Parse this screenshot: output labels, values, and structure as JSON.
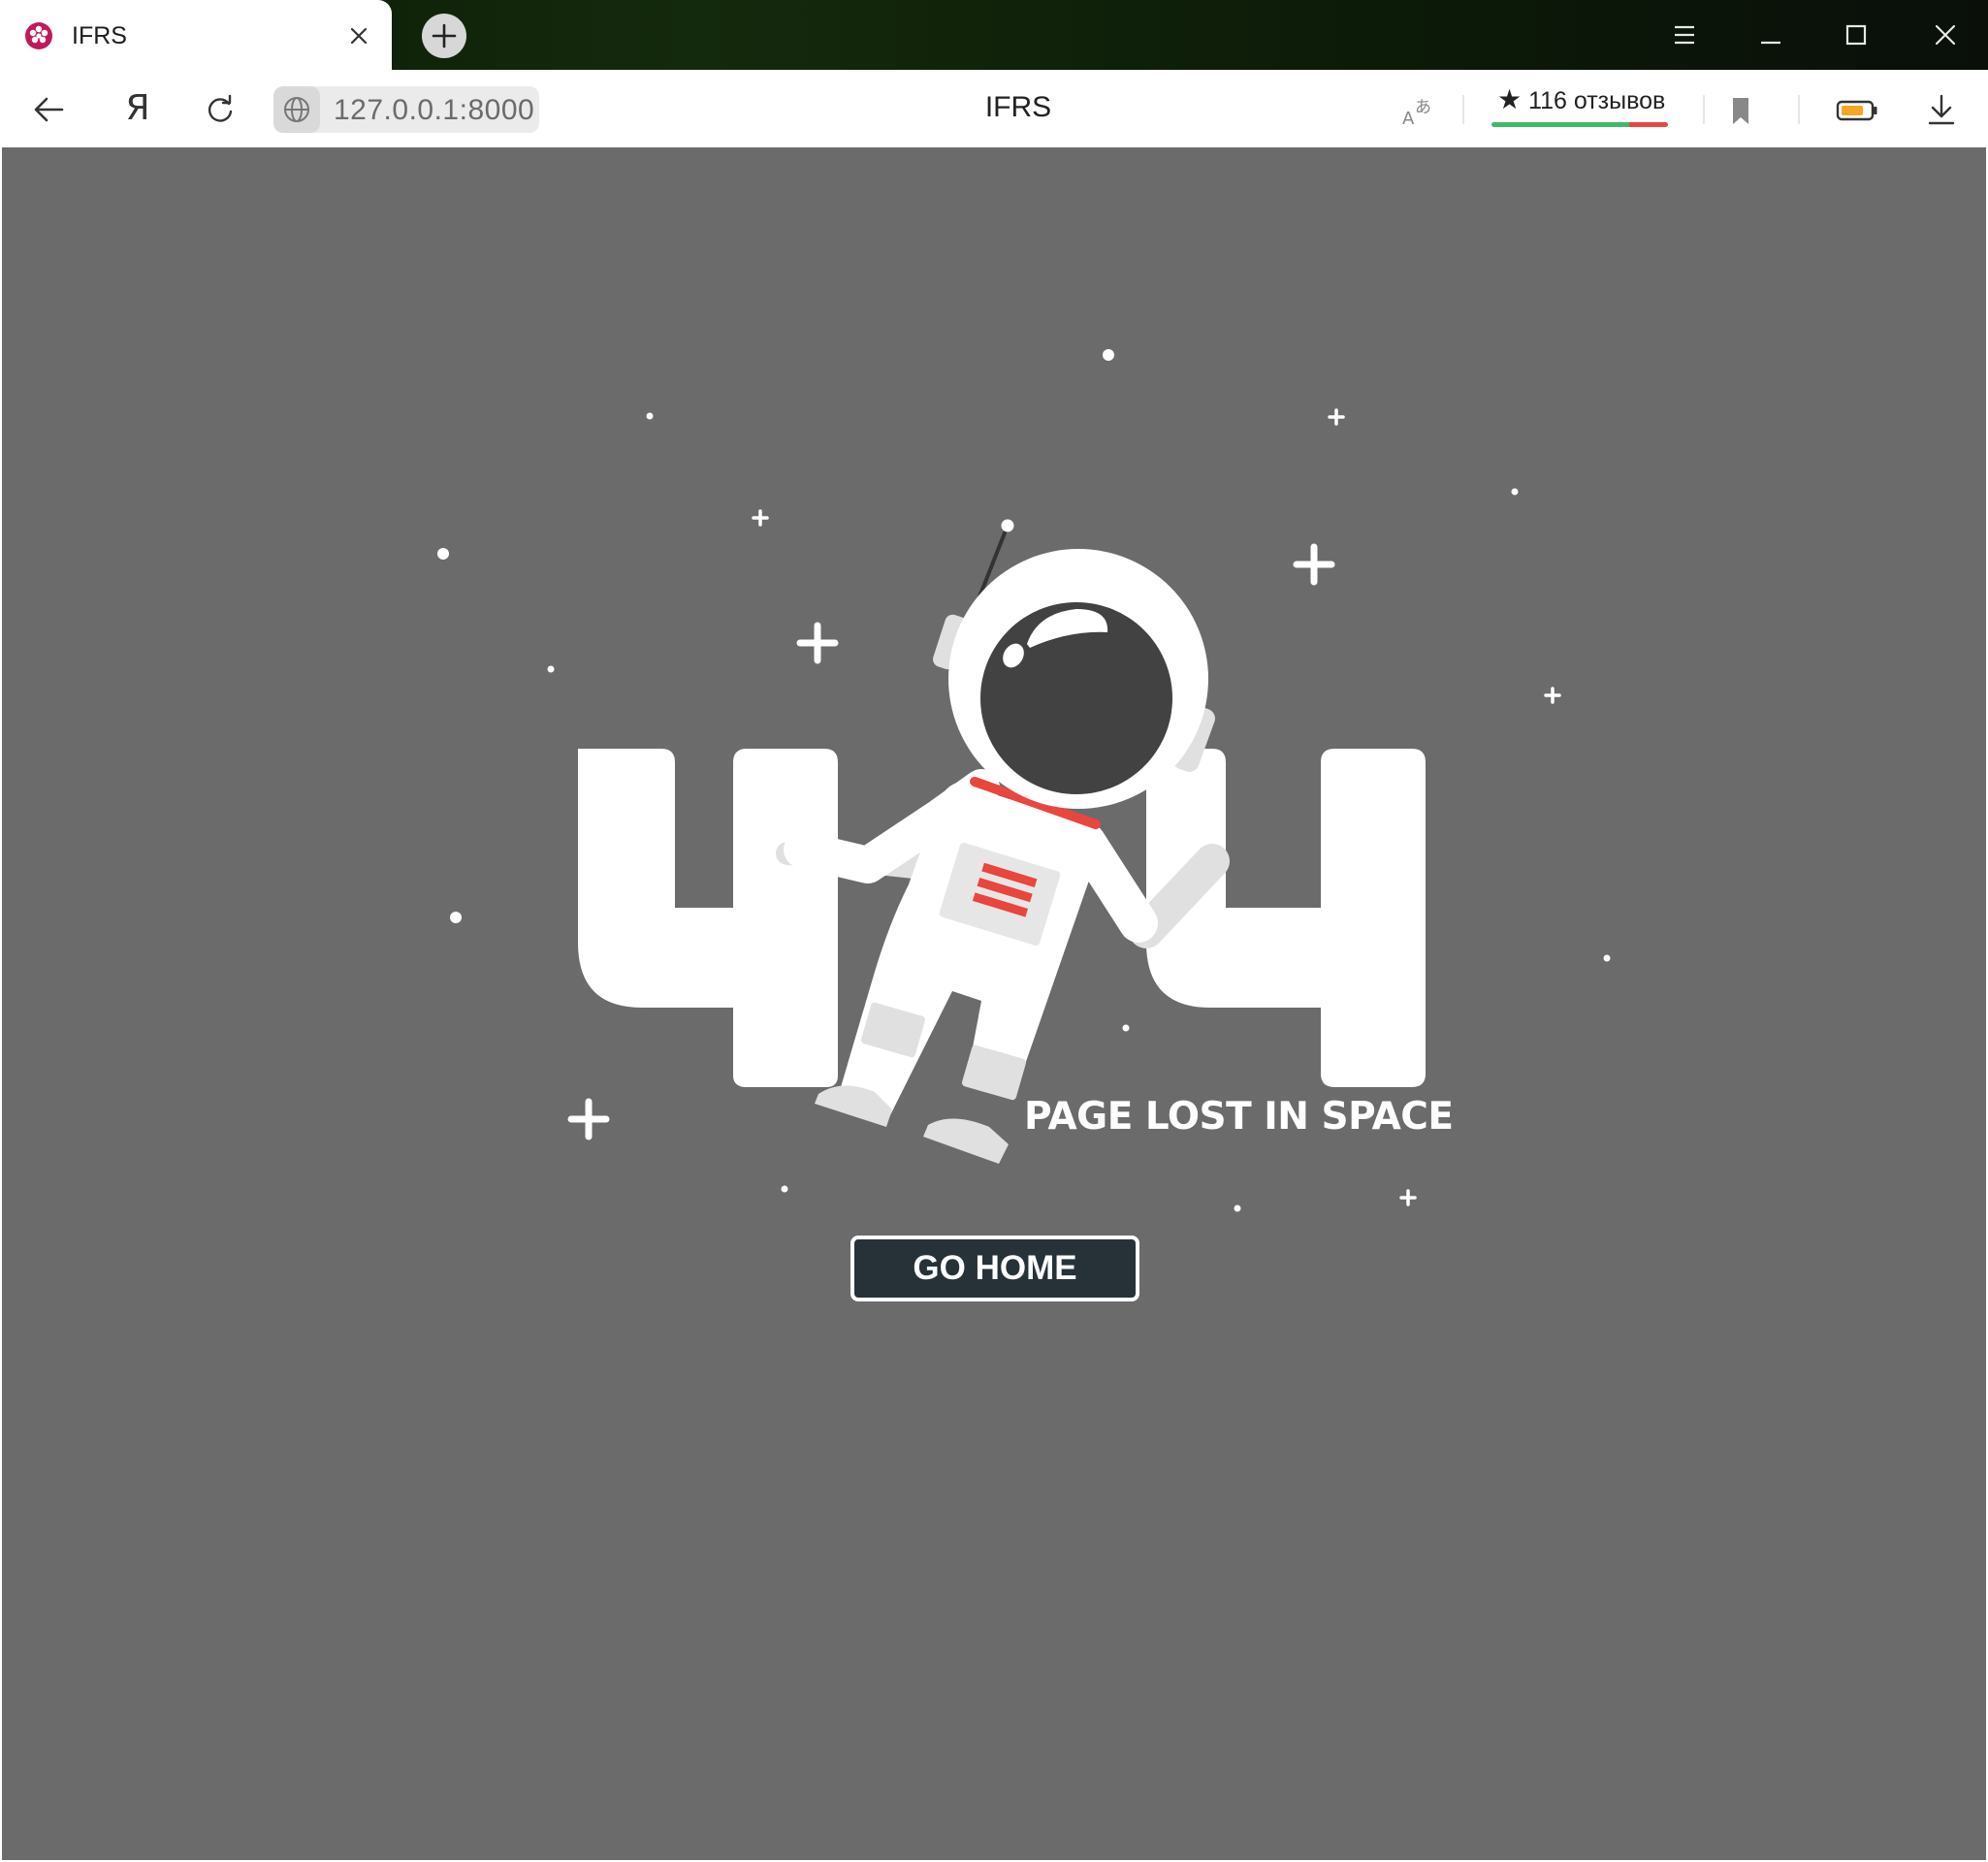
{
  "tab": {
    "title": "IFRS",
    "favicon": "raspberry-icon",
    "close_icon": "close-icon"
  },
  "window_controls": [
    "menu-icon",
    "minimize-icon",
    "maximize-icon",
    "close-icon"
  ],
  "toolbar": {
    "back_icon": "arrow-left-icon",
    "home_glyph": "Я",
    "reload_icon": "reload-icon",
    "address": "127.0.0.1:8000",
    "page_title": "IFRS",
    "translate_icon": "translate-icon",
    "reviews_star": "★",
    "reviews_label": "116 отзывов",
    "reviews_rating_fraction": 0.78,
    "bookmark_icon": "bookmark-icon",
    "battery_icon": "battery-icon",
    "download_icon": "download-icon"
  },
  "page": {
    "heading_number": "404",
    "subtitle": "PAGE LOST IN SPACE",
    "button_label": "GO HOME"
  },
  "colors": {
    "page_background": "#6b6b6b",
    "button_background": "#263238",
    "accent_red": "#e8463f",
    "favicon": "#c2185b",
    "battery_fill": "#f5a623",
    "rating_good": "#3fb86a",
    "rating_bad": "#e8463f"
  }
}
